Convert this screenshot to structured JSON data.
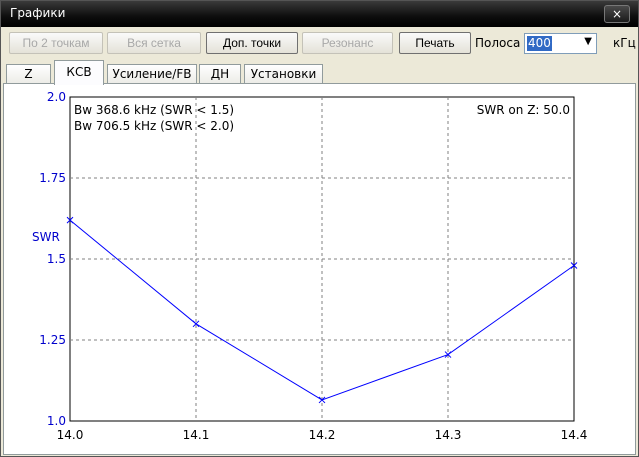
{
  "window": {
    "title": "Графики",
    "close_glyph": "×"
  },
  "toolbar": {
    "buttons": [
      {
        "label": "По 2 точкам",
        "enabled": false
      },
      {
        "label": "Вся сетка",
        "enabled": false
      },
      {
        "label": "Доп. точки",
        "enabled": true
      },
      {
        "label": "Резонанс",
        "enabled": false
      },
      {
        "label": "Печать",
        "enabled": true
      }
    ],
    "band_label": "Полоса",
    "band_value": "400",
    "band_unit": "кГц"
  },
  "tabs": [
    {
      "label": "Z",
      "active": false
    },
    {
      "label": "КСВ",
      "active": true
    },
    {
      "label": "Усиление/FB",
      "active": false
    },
    {
      "label": "ДН",
      "active": false
    },
    {
      "label": "Установки",
      "active": false
    }
  ],
  "colors": {
    "series": "#0000ff",
    "ytick": "#0000cc",
    "grid": "#808080"
  },
  "chart_data": {
    "type": "line",
    "title": "",
    "xlabel": "",
    "ylabel": "SWR",
    "xlim": [
      14.0,
      14.4
    ],
    "ylim": [
      1.0,
      2.0
    ],
    "x_ticks": [
      "14.0",
      "14.1",
      "14.2",
      "14.3",
      "14.4"
    ],
    "y_ticks": [
      "1.0",
      "1.25",
      "1.5",
      "1.75",
      "2.0"
    ],
    "grid": true,
    "series": [
      {
        "x": [
          14.0,
          14.1,
          14.2,
          14.3,
          14.4
        ],
        "y": [
          1.62,
          1.3,
          1.065,
          1.205,
          1.48
        ],
        "marker": "x"
      }
    ],
    "annotations": {
      "bandwidth": [
        "Bw 368.6 kHz (SWR < 1.5)",
        "Bw 706.5 kHz (SWR < 2.0)"
      ],
      "impedance": "SWR on Z: 50.0"
    }
  }
}
